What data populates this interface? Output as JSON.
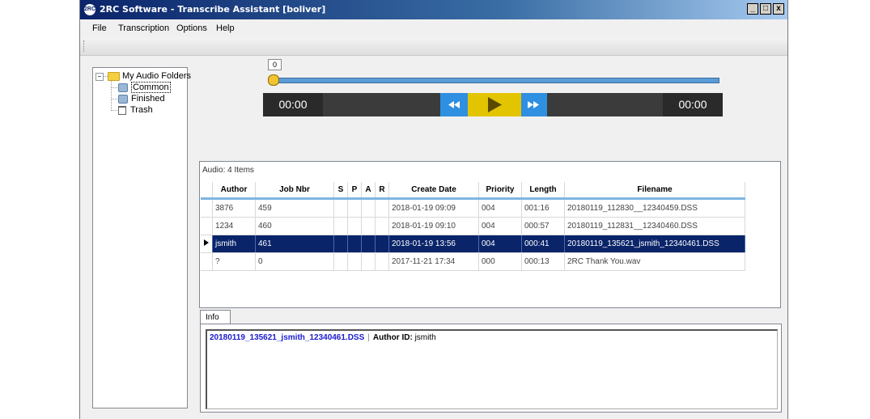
{
  "window": {
    "title": "2RC Software - Transcribe Assistant [boliver]",
    "icon_text": "2RC",
    "min_label": "_",
    "max_label": "□",
    "close_label": "x"
  },
  "menu": [
    "File",
    "Transcription",
    "Options",
    "Help"
  ],
  "tree": {
    "root": "My Audio Folders",
    "expander": "−",
    "children": [
      "Common",
      "Finished",
      "Trash"
    ],
    "selected": "Common"
  },
  "player": {
    "position_label": "0",
    "position_fraction": 0.0,
    "elapsed": "00:00",
    "total": "00:00"
  },
  "grid": {
    "caption": "Audio: 4 Items",
    "columns": [
      "Author",
      "Job Nbr",
      "S",
      "P",
      "A",
      "R",
      "Create Date",
      "Priority",
      "Length",
      "Filename"
    ],
    "rows": [
      {
        "author": "3876",
        "job": "459",
        "s": "",
        "p": "",
        "a": "",
        "r": "",
        "date": "2018-01-19 09:09",
        "priority": "004",
        "length": "001:16",
        "filename": "20180119_112830__12340459.DSS"
      },
      {
        "author": "1234",
        "job": "460",
        "s": "",
        "p": "",
        "a": "",
        "r": "",
        "date": "2018-01-19 09:10",
        "priority": "004",
        "length": "000:57",
        "filename": "20180119_112831__12340460.DSS"
      },
      {
        "author": "jsmith",
        "job": "461",
        "s": "",
        "p": "",
        "a": "",
        "r": "",
        "date": "2018-01-19 13:56",
        "priority": "004",
        "length": "000:41",
        "filename": "20180119_135621_jsmith_12340461.DSS"
      },
      {
        "author": "?",
        "job": "0",
        "s": "",
        "p": "",
        "a": "",
        "r": "",
        "date": "2017-11-21 17:34",
        "priority": "000",
        "length": "000:13",
        "filename": "2RC Thank You.wav"
      }
    ],
    "selected_row": 2
  },
  "info": {
    "tab": "Info",
    "filename": "20180119_135621_jsmith_12340461.DSS",
    "separator": "|",
    "author_label": "Author ID:",
    "author_value": "jsmith"
  },
  "colors": {
    "selection": "#0a246a",
    "seek_track": "#5b9bd5",
    "play_button": "#e3c400",
    "skip_buttons": "#2f8fe0"
  }
}
